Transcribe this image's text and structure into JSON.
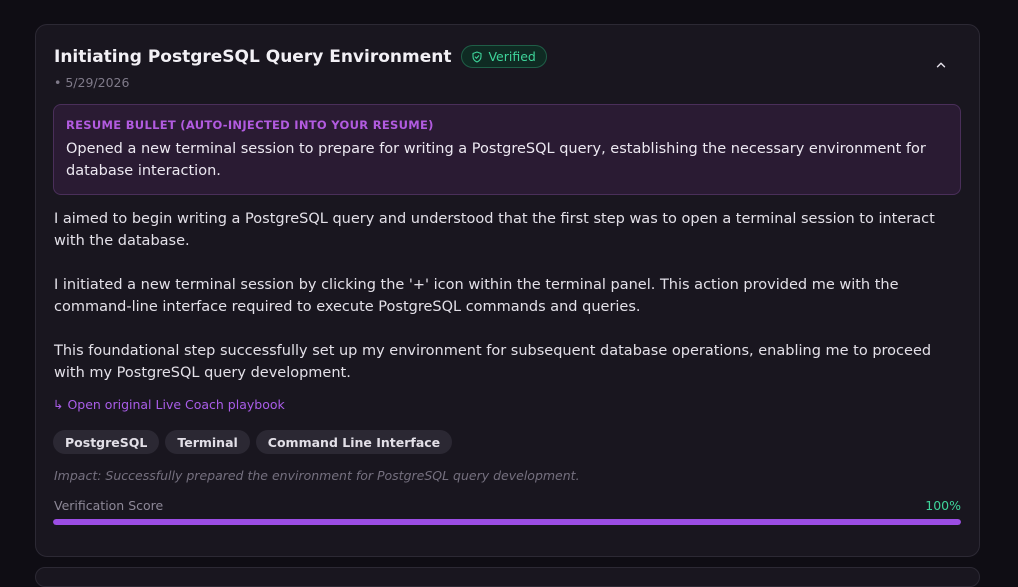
{
  "card": {
    "title": "Initiating PostgreSQL Query Environment",
    "badge_label": "Verified",
    "date": "• 5/29/2026",
    "resume": {
      "label": "RESUME BULLET (AUTO-INJECTED INTO YOUR RESUME)",
      "text": "Opened a new terminal session to prepare for writing a PostgreSQL query, establishing the necessary environment for database interaction."
    },
    "paragraphs": [
      "I aimed to begin writing a PostgreSQL query and understood that the first step was to open a terminal session to interact with the database.",
      "I initiated a new terminal session by clicking the '+' icon within the terminal panel. This action provided me with the command-line interface required to execute PostgreSQL commands and queries.",
      "This foundational step successfully set up my environment for subsequent database operations, enabling me to proceed with my PostgreSQL query development."
    ],
    "playbook_link": "↳ Open original Live Coach playbook",
    "tags": [
      "PostgreSQL",
      "Terminal",
      "Command Line Interface"
    ],
    "impact": "Impact: Successfully prepared the environment for PostgreSQL query development.",
    "score": {
      "label": "Verification Score",
      "value_text": "100%",
      "fraction": 1.0
    }
  },
  "icons": {
    "badge": "shield-check-icon",
    "collapse": "chevron-up-icon"
  },
  "colors": {
    "accent_purple": "#9b4de3",
    "verified_green": "#3ed49a",
    "card_bg": "#19161f",
    "page_bg": "#0f0d14"
  }
}
